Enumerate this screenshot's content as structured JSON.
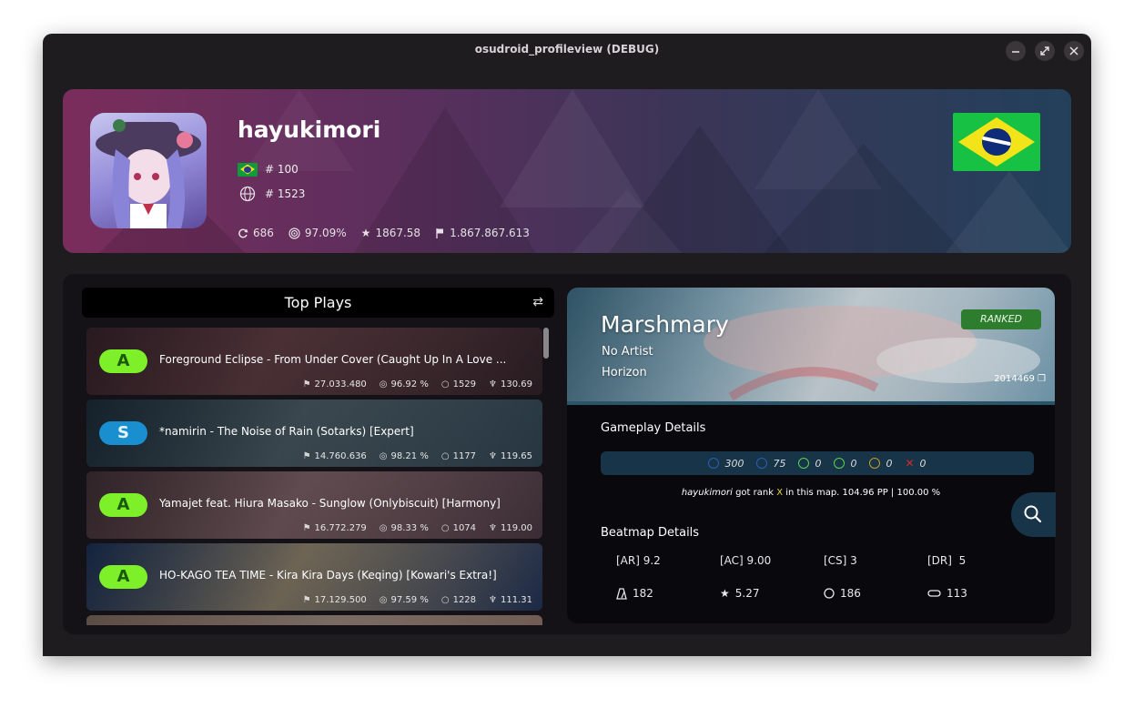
{
  "window": {
    "title": "osudroid_profileview (DEBUG)"
  },
  "profile": {
    "username": "hayukimori",
    "country_rank": "# 100",
    "global_rank": "# 1523",
    "stats": {
      "play_count": "686",
      "accuracy": "97.09%",
      "performance": "1867.58",
      "total_score": "1.867.867.613"
    }
  },
  "top_plays": {
    "title": "Top Plays",
    "items": [
      {
        "grade": "A",
        "title": "Foreground Eclipse - From Under Cover (Caught Up In A Love ...",
        "score": "27.033.480",
        "accuracy": "96.92 %",
        "combo": "1529",
        "pp": "130.69"
      },
      {
        "grade": "S",
        "title": "*namirin - The Noise of Rain (Sotarks) [Expert]",
        "score": "14.760.636",
        "accuracy": "98.21 %",
        "combo": "1177",
        "pp": "119.65"
      },
      {
        "grade": "A",
        "title": "Yamajet feat. Hiura Masako - Sunglow (Onlybiscuit) [Harmony]",
        "score": "16.772.279",
        "accuracy": "98.33 %",
        "combo": "1074",
        "pp": "119.00"
      },
      {
        "grade": "A",
        "title": "HO-KAGO TEA TIME - Kira Kira Days (Keqing) [Kowari's Extra!]",
        "score": "17.129.500",
        "accuracy": "97.59 %",
        "combo": "1228",
        "pp": "111.31"
      },
      {
        "grade": "",
        "title": "",
        "score": "",
        "accuracy": "",
        "combo": "",
        "pp": ""
      }
    ]
  },
  "beatmap": {
    "title": "Marshmary",
    "artist": "No Artist",
    "difficulty": "Horizon",
    "status": "RANKED",
    "id": "2014469",
    "gameplay_label": "Gameplay Details",
    "judgements": [
      {
        "value": "300",
        "color": "#2a5fae"
      },
      {
        "value": "75",
        "color": "#2a5fae"
      },
      {
        "value": "0",
        "color": "#5ad24a"
      },
      {
        "value": "0",
        "color": "#5ad24a"
      },
      {
        "value": "0",
        "color": "#c99a1e"
      },
      {
        "value": "0",
        "color": "#d42a2a"
      }
    ],
    "rank_sentence": {
      "user": "hayukimori",
      "pre": " got rank ",
      "rank": "X",
      "post": " in this map. 104.96 PP | 100.00 %"
    },
    "details_label": "Beatmap Details",
    "attrs": {
      "ar": "[AR] 9.2",
      "ac": "[AC] 9.00",
      "cs": "[CS] 3",
      "dr": "[DR]  5"
    },
    "extra": {
      "bpm": "182",
      "stars": "5.27",
      "circles": "186",
      "sliders": "113"
    }
  },
  "colors": {
    "grade_a": "#7ef02a",
    "grade_s": "#1a8fd0",
    "panel": "#141216",
    "accent": "#173449"
  }
}
